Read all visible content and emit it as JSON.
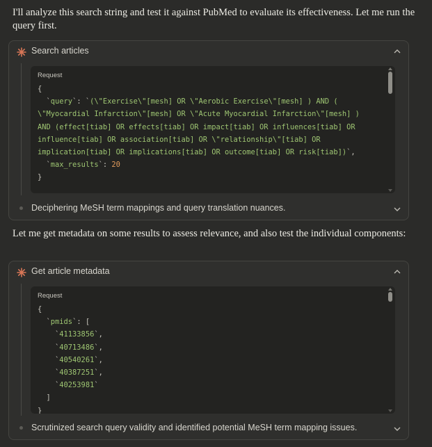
{
  "intro_text": "I'll analyze this search string and test it against PubMed to evaluate its effectiveness. Let me run the query first.",
  "middle_text": "Let me get metadata on some results to assess relevance, and also test the individual components:",
  "tool1": {
    "title": "Search articles",
    "request_label": "Request",
    "footer_text": "Deciphering MeSH term mappings and query translation nuances.",
    "query_key": "query",
    "query_value_lines": [
      "(\\\"Exercise\\\"[mesh] OR \\\"Aerobic Exercise\\\"[mesh] ) AND (",
      "\\\"Myocardial Infarction\\\"[mesh] OR \\\"Acute Myocardial Infarction\\\"[mesh] )",
      "AND (effect[tiab] OR effects[tiab] OR impact[tiab] OR influences[tiab] OR",
      "influence[tiab] OR association[tiab] OR \\\"relationship\\\"[tiab] OR",
      "implication[tiab] OR implications[tiab] OR outcome[tiab] OR risk[tiab])"
    ],
    "max_results_key": "max_results",
    "max_results_value": "20"
  },
  "tool2": {
    "title": "Get article metadata",
    "request_label": "Request",
    "footer_text": "Scrutinized search query validity and identified potential MeSH term mapping issues.",
    "pmids_key": "pmids",
    "pmids": [
      "41133856",
      "40713486",
      "40540261",
      "40387251",
      "40253981"
    ]
  },
  "colors": {
    "background": "#2b2b29",
    "card": "#2f2f2d",
    "code_bg": "#232321",
    "string": "#9ec572",
    "number": "#e09a5c",
    "spark": "#d97757"
  },
  "icons": {
    "tool_icon": "spark-icon",
    "collapse_icon": "chevron-up-icon",
    "expand_icon": "chevron-down-icon"
  }
}
